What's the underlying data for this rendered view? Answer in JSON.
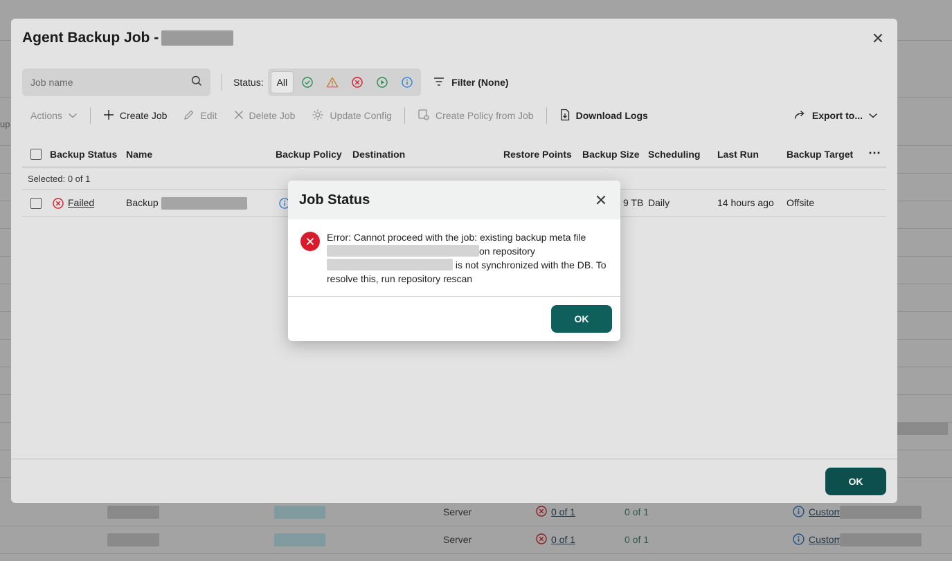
{
  "background": {
    "side_text": "up",
    "rows": [
      {
        "type": "Server",
        "points": "0 of 1",
        "copies": "0 of 1",
        "policy": "Custom"
      },
      {
        "type": "Server",
        "points": "0 of 1",
        "copies": "0 of 1",
        "policy": "Custom"
      }
    ]
  },
  "dialog": {
    "title": "Agent Backup Job -",
    "search": {
      "placeholder": "Job name",
      "value": ""
    },
    "status": {
      "label": "Status:",
      "all_label": "All",
      "icons": [
        "success-icon",
        "warning-icon",
        "error-icon",
        "running-icon",
        "info-icon"
      ]
    },
    "filter_label": "Filter (None)",
    "toolbar": {
      "actions": "Actions",
      "create_job": "Create Job",
      "edit": "Edit",
      "delete_job": "Delete Job",
      "update_config": "Update Config",
      "create_policy": "Create Policy from Job",
      "download_logs": "Download Logs",
      "export": "Export to..."
    },
    "table": {
      "columns": [
        "Backup Status",
        "Name",
        "Backup Policy",
        "Destination",
        "Restore Points",
        "Backup Size",
        "Scheduling",
        "Last Run",
        "Backup Target"
      ],
      "selected_text": "Selected: 0 of 1",
      "row": {
        "status": "Failed",
        "name": "Backup",
        "backup_size": "9 TB",
        "scheduling": "Daily",
        "last_run": "14 hours ago",
        "backup_target": "Offsite"
      }
    },
    "ok_label": "OK"
  },
  "modal": {
    "title": "Job Status",
    "message_part1": "Error: Cannot proceed with the job: existing backup meta file",
    "message_part2": "on repository",
    "message_part3": "is not synchronized with the DB. To resolve this, run repository rescan",
    "ok_label": "OK"
  },
  "colors": {
    "primary_button": "#0f5f5d",
    "error": "#d81c2b",
    "success": "#2e8b57",
    "warning": "#c77a1e",
    "info": "#2b7bd1"
  }
}
